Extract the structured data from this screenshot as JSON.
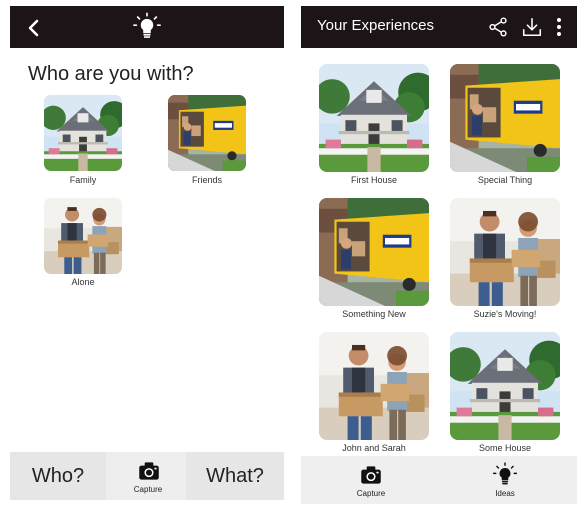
{
  "left_screen": {
    "header": {
      "back_icon": "chevron-left-icon",
      "logo_icon": "lightbulb-icon"
    },
    "prompt": "Who are you with?",
    "options": [
      {
        "label": "Family",
        "image": "house-photo"
      },
      {
        "label": "Friends",
        "image": "moving-truck-photo"
      },
      {
        "label": "Alone",
        "image": "couple-boxes-photo"
      }
    ],
    "bottom_bar": {
      "who_label": "Who?",
      "capture_label": "Capture",
      "what_label": "What?"
    }
  },
  "right_screen": {
    "header": {
      "title": "Your Experiences",
      "share_icon": "share-icon",
      "download_icon": "download-icon",
      "menu_icon": "more-vertical-icon"
    },
    "experiences": [
      {
        "label": "First House",
        "image": "house-photo"
      },
      {
        "label": "Special Thing",
        "image": "moving-truck-photo"
      },
      {
        "label": "Something New",
        "image": "moving-truck-photo"
      },
      {
        "label": "Suzie's Moving!",
        "image": "couple-boxes-photo"
      },
      {
        "label": "John and Sarah",
        "image": "couple-boxes-photo"
      },
      {
        "label": "Some House",
        "image": "house-photo"
      }
    ],
    "bottom_bar": {
      "capture_label": "Capture",
      "ideas_label": "Ideas"
    }
  },
  "colors": {
    "header_bg": "#1c1416",
    "bar_bg": "#eeeeee",
    "truck_yellow": "#f2c417",
    "sky": "#cfe3f2",
    "grass": "#5b9a3c"
  }
}
